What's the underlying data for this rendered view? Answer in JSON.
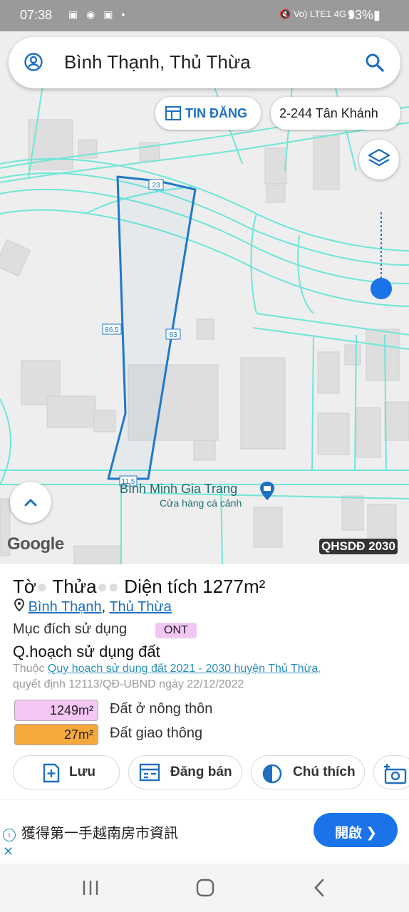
{
  "status_bar": {
    "time": "07:38",
    "left_icons": [
      "notification-icon",
      "messenger-icon",
      "notification-icon",
      "dot-icon"
    ],
    "network": "Vo) LTE1 4G",
    "battery": "93%"
  },
  "search": {
    "title": "Bình Thạnh, Thủ Thừa"
  },
  "chips": {
    "tin_dang": "TIN ĐĂNG",
    "address": "2-244 Tân Khánh"
  },
  "map": {
    "edge_labels": [
      "23",
      "86.5",
      "83",
      "11.5"
    ],
    "poi_name": "Bình Minh Gia Trang",
    "poi_type": "Cửa hàng cá cảnh",
    "attribution": "Google",
    "plan_badge": "QHSDĐ 2030",
    "colors": {
      "parcel_outline": "#1f78c8",
      "roads": "#6ee6d8",
      "buildings": "#dcdcdc"
    }
  },
  "parcel": {
    "title_prefix": "Tờ",
    "title_mid": "Thửa",
    "area_label": "Diện tích",
    "area_value": "1277m²",
    "commune": "Bình Thạnh",
    "district": "Thủ Thừa",
    "purpose_label": "Mục đích sử dụng",
    "purpose_code": "ONT",
    "plan_title": "Q.hoạch sử dụng đất",
    "plan_prefix": "Thuộc",
    "plan_link": "Quy hoạch sử dụng đất 2021 - 2030 huyện Thủ Thừa",
    "plan_decision": "quyết định 12113/QĐ-UBND ngày 22/12/2022",
    "land_uses": [
      {
        "area": "1249m²",
        "label": "Đất ở nông thôn",
        "color": "#f4c6f4"
      },
      {
        "area": "27m²",
        "label": "Đất giao thông",
        "color": "#f5a83c"
      }
    ]
  },
  "actions": {
    "save": "Lưu",
    "post_sale": "Đăng bán",
    "legend": "Chú thích"
  },
  "ad": {
    "text": "獲得第一手越南房市資訊",
    "button": "開啟 ❯"
  }
}
